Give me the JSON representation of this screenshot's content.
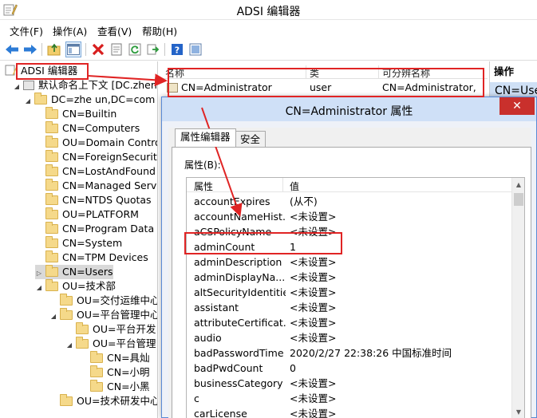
{
  "window": {
    "title": "ADSI 编辑器"
  },
  "menu": [
    "文件(F)",
    "操作(A)",
    "查看(V)",
    "帮助(H)"
  ],
  "toolbar_icons": [
    "back-arrow-icon",
    "forward-arrow-icon",
    "folder-up-icon",
    "show-hide-tree-icon",
    "delete-icon",
    "properties-icon",
    "refresh-icon",
    "export-list-icon",
    "help-icon",
    "console-icon"
  ],
  "tree": {
    "root": "ADSI 编辑器",
    "items": [
      {
        "label": "默认命名上下文 [DC.zhenyu",
        "depth": 1,
        "expander": "◢"
      },
      {
        "label": "DC=zhe  un,DC=com",
        "depth": 2,
        "expander": "◢"
      },
      {
        "label": "CN=Builtin",
        "depth": 3,
        "expander": ""
      },
      {
        "label": "CN=Computers",
        "depth": 3,
        "expander": ""
      },
      {
        "label": "OU=Domain Contro",
        "depth": 3,
        "expander": ""
      },
      {
        "label": "CN=ForeignSecurit",
        "depth": 3,
        "expander": ""
      },
      {
        "label": "CN=LostAndFound",
        "depth": 3,
        "expander": ""
      },
      {
        "label": "CN=Managed Serv",
        "depth": 3,
        "expander": ""
      },
      {
        "label": "CN=NTDS Quotas",
        "depth": 3,
        "expander": ""
      },
      {
        "label": "OU=PLATFORM",
        "depth": 3,
        "expander": ""
      },
      {
        "label": "CN=Program Data",
        "depth": 3,
        "expander": ""
      },
      {
        "label": "CN=System",
        "depth": 3,
        "expander": ""
      },
      {
        "label": "CN=TPM Devices",
        "depth": 3,
        "expander": ""
      },
      {
        "label": "CN=Users",
        "depth": 3,
        "expander": "▷",
        "selected": true
      },
      {
        "label": "OU=技术部",
        "depth": 3,
        "expander": "◢"
      },
      {
        "label": "OU=交付运维中心",
        "depth": 4,
        "expander": ""
      },
      {
        "label": "OU=平台管理中心",
        "depth": 4,
        "expander": "◢"
      },
      {
        "label": "OU=平台开发",
        "depth": 5,
        "expander": ""
      },
      {
        "label": "OU=平台管理",
        "depth": 5,
        "expander": "◢"
      },
      {
        "label": "CN=具灿",
        "depth": 6,
        "expander": ""
      },
      {
        "label": "CN=小明",
        "depth": 6,
        "expander": ""
      },
      {
        "label": "CN=小黑",
        "depth": 6,
        "expander": ""
      },
      {
        "label": "OU=技术研发中心",
        "depth": 4,
        "expander": ""
      }
    ]
  },
  "list": {
    "columns": [
      "名称",
      "类",
      "可分辨名称"
    ],
    "row": {
      "name": "CN=Administrator",
      "class": "user",
      "dn": "CN=Administrator,"
    }
  },
  "actions": {
    "header": "操作",
    "item": "CN=Use"
  },
  "dialog": {
    "title": "CN=Administrator 属性",
    "close": "✕",
    "tabs": [
      "属性编辑器",
      "安全"
    ],
    "attributes_label": "属性(B):",
    "columns": [
      "属性",
      "值"
    ],
    "rows": [
      {
        "name": "accountExpires",
        "value": "(从不)"
      },
      {
        "name": "accountNameHist...",
        "value": "<未设置>"
      },
      {
        "name": "aCSPolicyName",
        "value": "<未设置>"
      },
      {
        "name": "adminCount",
        "value": "1"
      },
      {
        "name": "adminDescription",
        "value": "<未设置>"
      },
      {
        "name": "adminDisplayNa...",
        "value": "<未设置>"
      },
      {
        "name": "altSecurityIdentities",
        "value": "<未设置>"
      },
      {
        "name": "assistant",
        "value": "<未设置>"
      },
      {
        "name": "attributeCertificat...",
        "value": "<未设置>"
      },
      {
        "name": "audio",
        "value": "<未设置>"
      },
      {
        "name": "badPasswordTime",
        "value": "2020/2/27 22:38:26 中国标准时间"
      },
      {
        "name": "badPwdCount",
        "value": "0"
      },
      {
        "name": "businessCategory",
        "value": "<未设置>"
      },
      {
        "name": "c",
        "value": "<未设置>"
      },
      {
        "name": "carLicense",
        "value": "<未设置>"
      }
    ]
  }
}
